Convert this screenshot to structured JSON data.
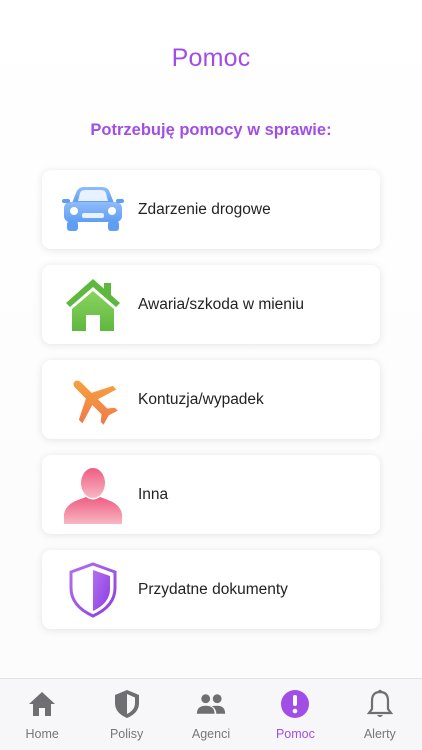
{
  "header": {
    "title": "Pomoc"
  },
  "help": {
    "section_title": "Potrzebuję pomocy w sprawie:",
    "items": [
      {
        "label": "Zdarzenie drogowe",
        "icon": "car-icon",
        "color": "#6ea8f7"
      },
      {
        "label": "Awaria/szkoda w mieniu",
        "icon": "house-icon",
        "color": "#6cc24a"
      },
      {
        "label": "Kontuzja/wypadek",
        "icon": "airplane-icon",
        "color": "#f3a23c"
      },
      {
        "label": "Inna",
        "icon": "person-icon",
        "color": "#f06a8a"
      },
      {
        "label": "Przydatne dokumenty",
        "icon": "shield-icon",
        "color": "#a14ee6"
      }
    ]
  },
  "tabbar": {
    "active": "Pomoc",
    "active_color": "#a14ee6",
    "inactive_color": "#777777",
    "tabs": [
      {
        "label": "Home",
        "icon": "home-icon"
      },
      {
        "label": "Polisy",
        "icon": "shield-icon"
      },
      {
        "label": "Agenci",
        "icon": "people-icon"
      },
      {
        "label": "Pomoc",
        "icon": "alert-circle-icon"
      },
      {
        "label": "Alerty",
        "icon": "bell-icon"
      }
    ]
  }
}
